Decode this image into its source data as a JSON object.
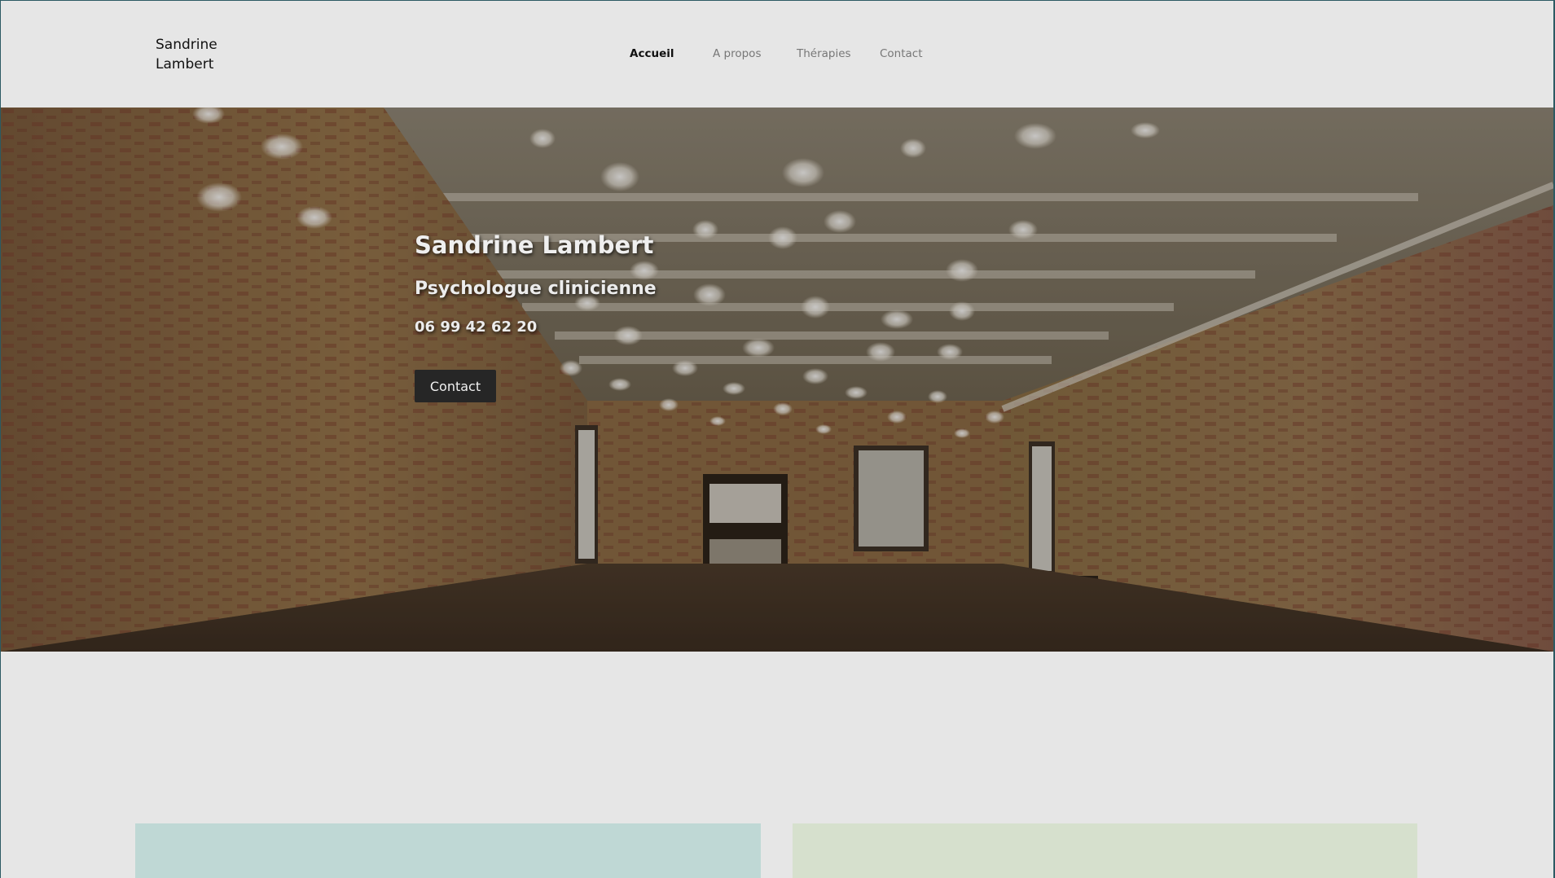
{
  "site": {
    "title": "Sandrine Lambert"
  },
  "nav": {
    "items": [
      {
        "label": "Accueil",
        "active": true
      },
      {
        "label": "A propos",
        "active": false
      },
      {
        "label": "Thérapies",
        "active": false
      },
      {
        "label": "Contact",
        "active": false
      }
    ]
  },
  "hero": {
    "title": "Sandrine Lambert",
    "subtitle": "Psychologue clinicienne",
    "phone": "06 99 42 62 20",
    "button_label": "Contact",
    "image": "brick-loft-hanging-lights"
  },
  "cards": [
    {
      "color": "#bfd8d5"
    },
    {
      "color": "#d6e0cd"
    }
  ],
  "colors": {
    "background": "#e6e6e6",
    "button": "#262626",
    "frame": "#2c5a63"
  }
}
